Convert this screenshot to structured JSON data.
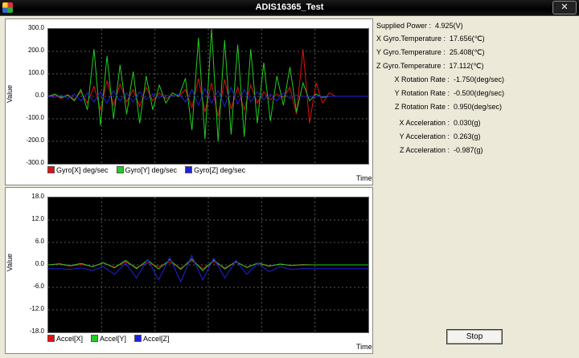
{
  "window": {
    "title": "ADIS16365_Test",
    "close_label": "✕"
  },
  "gyro_chart": {
    "ylabel": "Value",
    "xlabel": "Time",
    "ticks": [
      "300.0",
      "200.0",
      "100.0",
      "0.0",
      "-100.0",
      "-200.0",
      "-300.0"
    ],
    "legend": [
      {
        "label": "Gyro[X] deg/sec",
        "color": "#e01010"
      },
      {
        "label": "Gyro[Y] deg/sec",
        "color": "#22cc22"
      },
      {
        "label": "Gyro[Z] deg/sec",
        "color": "#2020e0"
      }
    ]
  },
  "accel_chart": {
    "ylabel": "Value",
    "xlabel": "Time",
    "ticks": [
      "18.0",
      "12.0",
      "6.0",
      "0.0",
      "-6.0",
      "-12.0",
      "-18.0"
    ],
    "legend": [
      {
        "label": "Accel[X]",
        "color": "#e01010"
      },
      {
        "label": "Accel[Y]",
        "color": "#22cc22"
      },
      {
        "label": "Accel[Z]",
        "color": "#2020e0"
      }
    ]
  },
  "chart_data": [
    {
      "type": "line",
      "ylabel": "Value",
      "xlabel": "Time",
      "ylim": [
        -300,
        300
      ],
      "series": [
        {
          "name": "Gyro[X] deg/sec",
          "color": "#e01010",
          "values": [
            0,
            5,
            -10,
            8,
            -15,
            20,
            -30,
            45,
            -60,
            70,
            -40,
            55,
            -25,
            30,
            -45,
            40,
            -20,
            15,
            -10,
            5,
            0,
            30,
            -50,
            80,
            -70,
            60,
            -90,
            75,
            -55,
            40,
            -60,
            50,
            -30,
            20,
            -15,
            10,
            -5,
            40,
            -80,
            210,
            -120,
            60,
            -30,
            15,
            0,
            0,
            0,
            0,
            0,
            0
          ]
        },
        {
          "name": "Gyro[Y] deg/sec",
          "color": "#22cc22",
          "values": [
            0,
            10,
            -5,
            5,
            -20,
            30,
            -60,
            210,
            -130,
            180,
            -100,
            140,
            -80,
            110,
            -120,
            90,
            -60,
            50,
            -30,
            15,
            0,
            80,
            -150,
            260,
            -190,
            300,
            -200,
            250,
            -170,
            230,
            -180,
            210,
            -120,
            150,
            -110,
            90,
            -40,
            130,
            -70,
            60,
            -20,
            10,
            -5,
            0,
            0,
            0,
            0,
            0,
            0,
            0
          ]
        },
        {
          "name": "Gyro[Z] deg/sec",
          "color": "#2020e0",
          "values": [
            0,
            -5,
            5,
            -10,
            10,
            -20,
            15,
            -25,
            20,
            -30,
            25,
            -20,
            15,
            -25,
            20,
            -15,
            10,
            -5,
            5,
            0,
            10,
            -25,
            30,
            -40,
            35,
            -30,
            25,
            -45,
            40,
            -35,
            30,
            -25,
            20,
            -15,
            10,
            -20,
            15,
            -10,
            5,
            0,
            0,
            0,
            0,
            0,
            0,
            0,
            0,
            0,
            0,
            0
          ]
        }
      ]
    },
    {
      "type": "line",
      "ylabel": "Value",
      "xlabel": "Time",
      "ylim": [
        -18,
        18
      ],
      "series": [
        {
          "name": "Accel[X]",
          "color": "#e01010",
          "values": [
            0,
            0.2,
            -0.3,
            0.1,
            -0.4,
            0.5,
            -0.6,
            0.8,
            -0.7,
            0.6,
            -0.5,
            0.7,
            -0.9,
            1.1,
            -1.0,
            0.9,
            -0.8,
            0.7,
            -0.6,
            0.5,
            -0.4,
            0.3,
            -0.2,
            0.1,
            0,
            0,
            0,
            0,
            0,
            0
          ]
        },
        {
          "name": "Accel[Y]",
          "color": "#22cc22",
          "values": [
            0,
            0.3,
            -0.2,
            0.4,
            -0.5,
            0.6,
            -0.8,
            1.2,
            -1.0,
            1.3,
            -1.1,
            1.4,
            -1.2,
            1.6,
            -1.5,
            1.3,
            -1.1,
            0.9,
            -0.7,
            0.5,
            -0.3,
            0.2,
            -0.1,
            0,
            0,
            0,
            0,
            0,
            0,
            0
          ]
        },
        {
          "name": "Accel[Z]",
          "color": "#2020e0",
          "values": [
            -1,
            -1,
            -1.2,
            -0.8,
            -1.5,
            -0.5,
            -2.5,
            0.5,
            -3.5,
            1.5,
            -4,
            2,
            -4.5,
            2.5,
            -4,
            1.8,
            -3.5,
            1.2,
            -2.5,
            0.5,
            -1.8,
            -0.5,
            -1.2,
            -1,
            -1,
            -1,
            -1,
            -1,
            -1,
            -1
          ]
        }
      ]
    }
  ],
  "readouts": [
    {
      "label": "Supplied Power :",
      "value": "4.925(V)"
    },
    {
      "label": "X Gyro.Temperature :",
      "value": "17.656(℃)"
    },
    {
      "label": "Y Gyro.Temperature :",
      "value": "25.408(℃)"
    },
    {
      "label": "Z Gyro.Temperature :",
      "value": "17.112(℃)"
    },
    {
      "label": "X Rotation Rate :",
      "value": "-1.750(deg/sec)"
    },
    {
      "label": "Y Rotation Rate :",
      "value": "-0.500(deg/sec)"
    },
    {
      "label": "Z Rotation Rate :",
      "value": "0.950(deg/sec)"
    },
    {
      "label": "X Acceleration :",
      "value": "0.030(g)"
    },
    {
      "label": "Y Acceleration :",
      "value": "0.263(g)"
    },
    {
      "label": "Z Acceleration :",
      "value": "-0.987(g)"
    }
  ],
  "stop_label": "Stop"
}
